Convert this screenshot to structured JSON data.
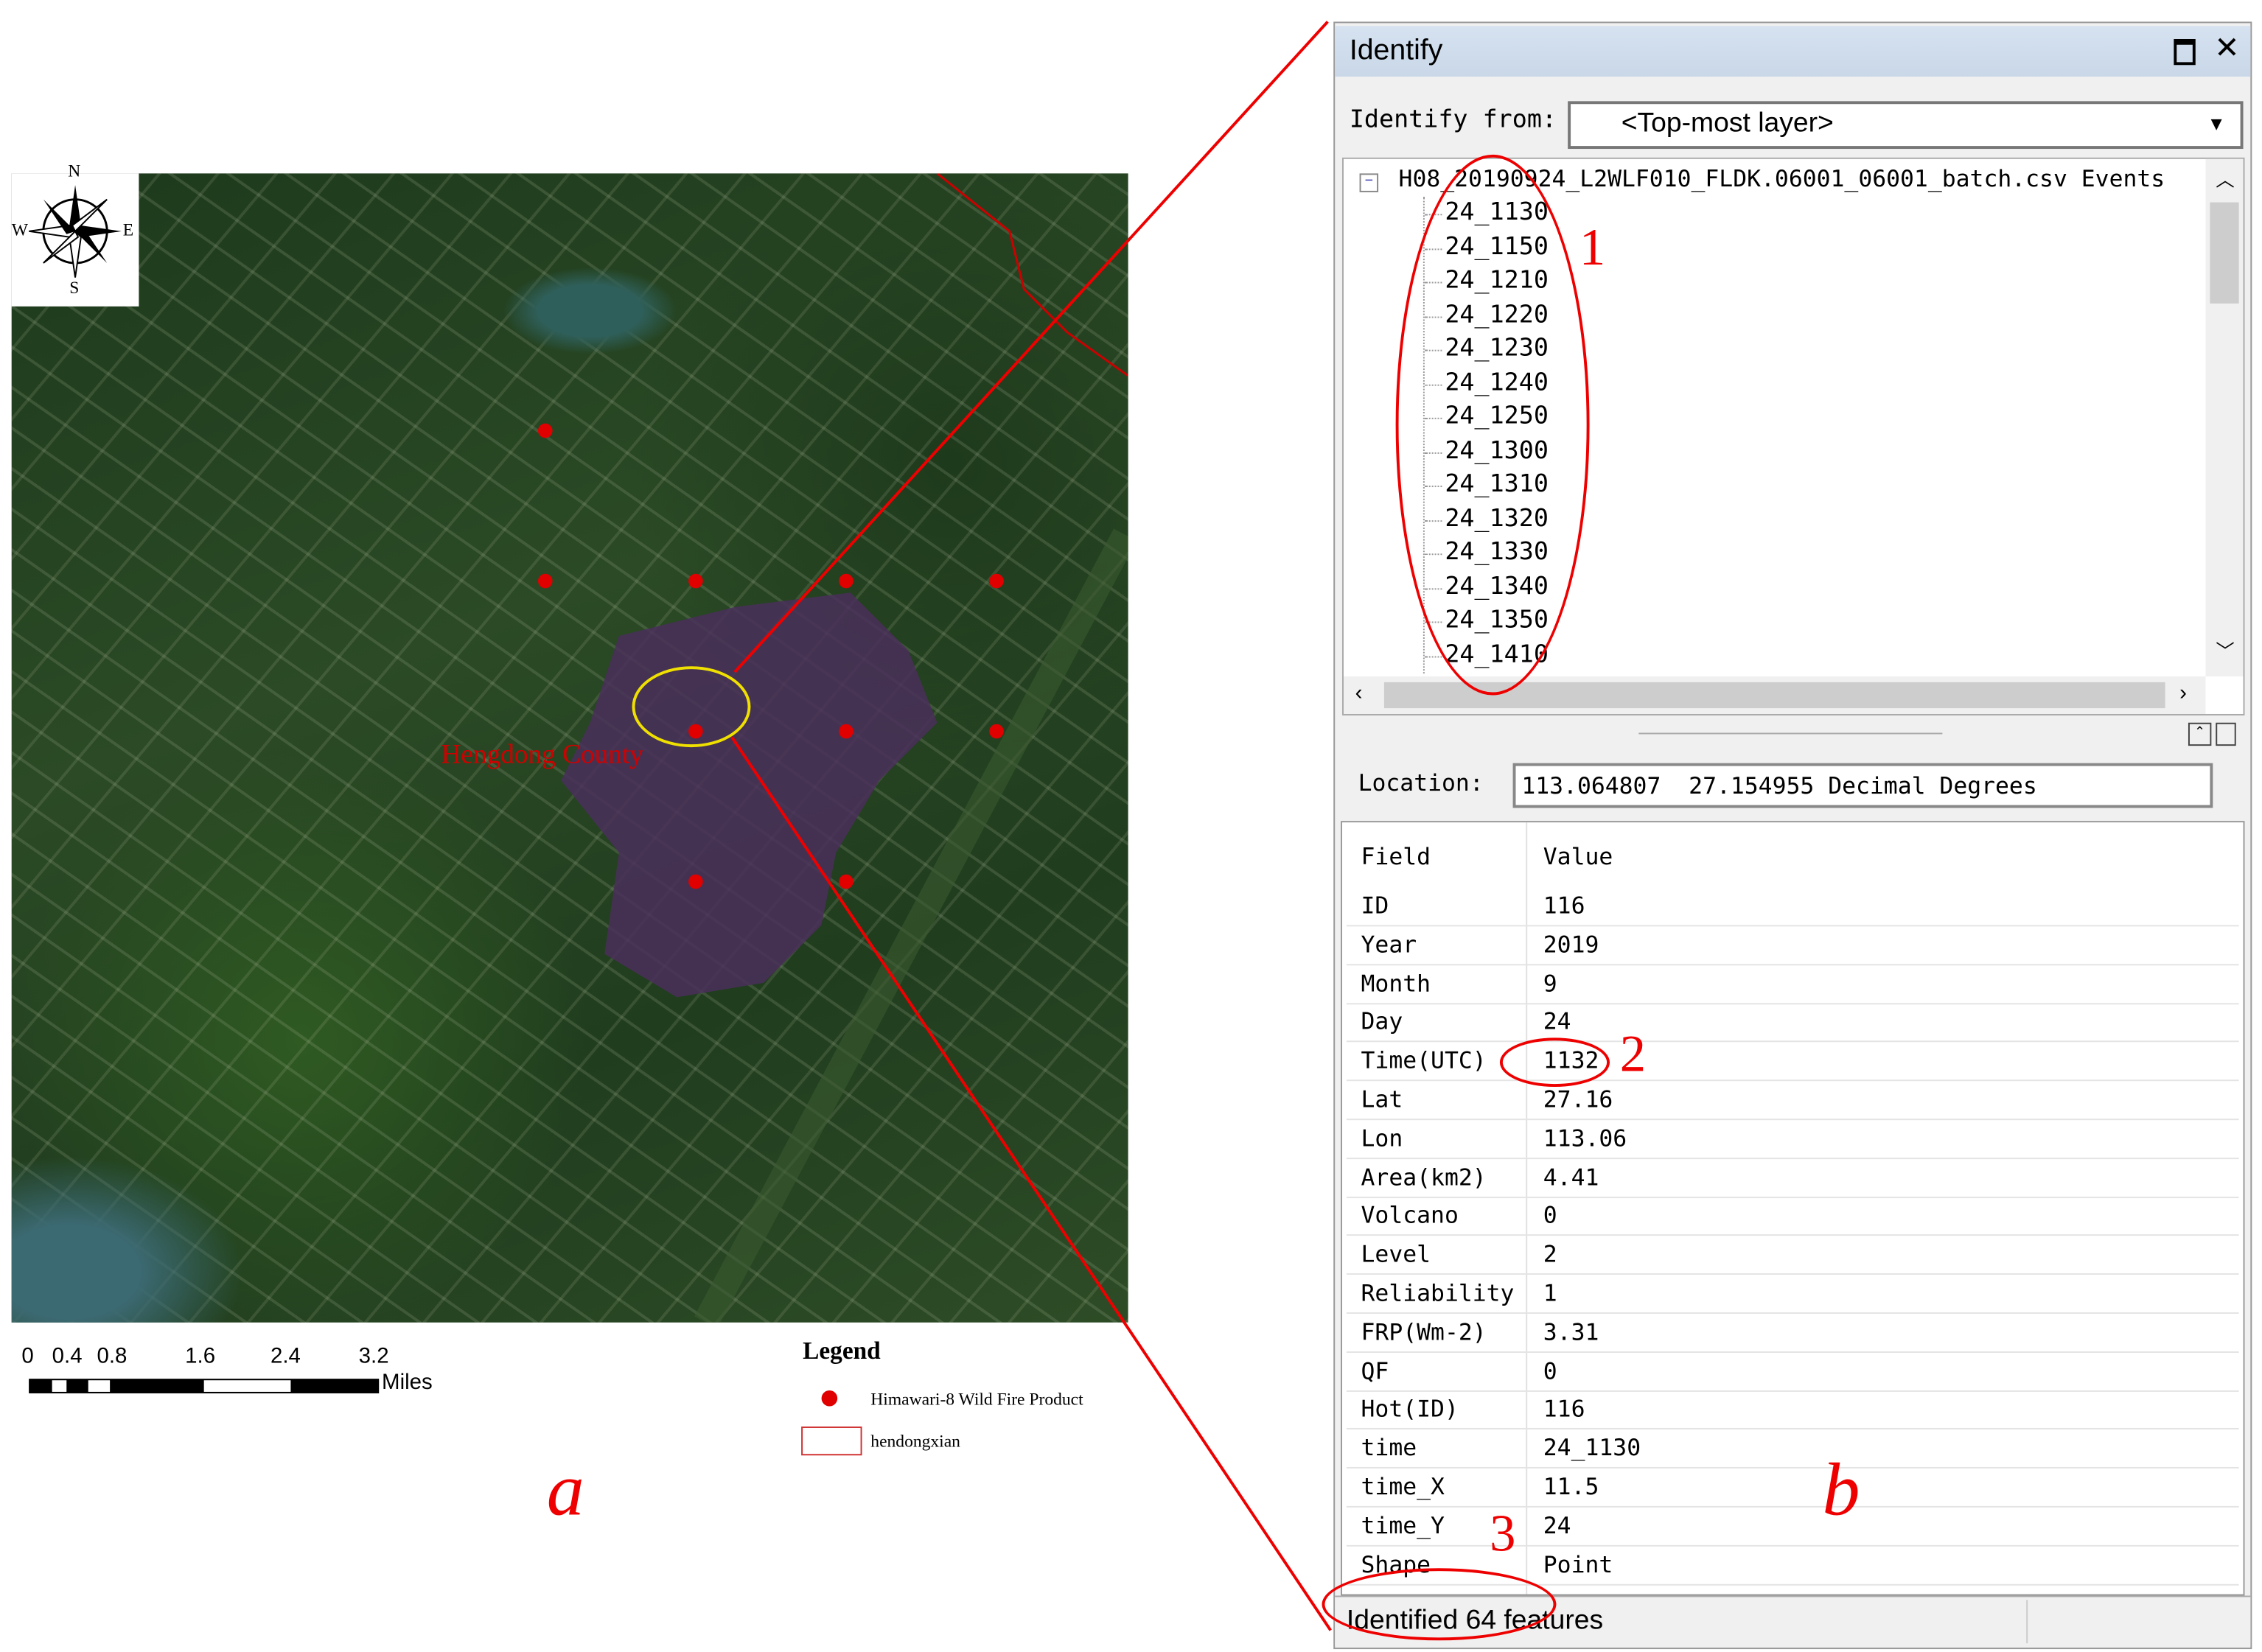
{
  "map": {
    "label": "Hengdong County",
    "compass": {
      "n": "N",
      "s": "S",
      "e": "E",
      "w": "W"
    },
    "scale": {
      "ticks": [
        "0",
        "0.4",
        "0.8",
        "1.6",
        "2.4",
        "3.2"
      ],
      "unit": "Miles"
    },
    "legend": {
      "title": "Legend",
      "items": [
        {
          "label": "Himawari-8 Wild Fire Product",
          "symbol": "red-dot"
        },
        {
          "label": "hendongxian",
          "symbol": "red-outline-box"
        }
      ]
    },
    "fire_points_count": 10,
    "colors": {
      "fire": "#e00000",
      "highlight": "#f0e000",
      "burn": "#4a2f5a"
    }
  },
  "panel": {
    "title": "Identify",
    "identify_from_label": "Identify from:",
    "identify_from_value": "<Top-most layer>",
    "layer_name": "H08_20190924_L2WLF010_FLDK.06001_06001_batch.csv Events",
    "tree_items": [
      "24_1130",
      "24_1150",
      "24_1210",
      "24_1220",
      "24_1230",
      "24_1240",
      "24_1250",
      "24_1300",
      "24_1310",
      "24_1320",
      "24_1330",
      "24_1340",
      "24_1350",
      "24_1410"
    ],
    "location_label": "Location:",
    "location_value": "113.064807  27.154955 Decimal Degrees",
    "table_headers": {
      "field": "Field",
      "value": "Value"
    },
    "rows": [
      {
        "field": "ID",
        "value": "116"
      },
      {
        "field": "Year",
        "value": "2019"
      },
      {
        "field": "Month",
        "value": "9"
      },
      {
        "field": "Day",
        "value": "24"
      },
      {
        "field": "Time(UTC)",
        "value": "1132"
      },
      {
        "field": "Lat",
        "value": "27.16"
      },
      {
        "field": "Lon",
        "value": "113.06"
      },
      {
        "field": "Area(km2)",
        "value": "4.41"
      },
      {
        "field": "Volcano",
        "value": "0"
      },
      {
        "field": "Level",
        "value": "2"
      },
      {
        "field": "Reliability",
        "value": "1"
      },
      {
        "field": "FRP(Wm-2)",
        "value": "3.31"
      },
      {
        "field": "QF",
        "value": "0"
      },
      {
        "field": "Hot(ID)",
        "value": "116"
      },
      {
        "field": "time",
        "value": "24_1130"
      },
      {
        "field": "time_X",
        "value": "11.5"
      },
      {
        "field": "time_Y",
        "value": "24"
      },
      {
        "field": "Shape",
        "value": "Point"
      }
    ],
    "status": "Identified 64 features"
  },
  "annotations": {
    "n1": "1",
    "n2": "2",
    "n3": "3",
    "label_a": "a",
    "label_b": "b"
  }
}
